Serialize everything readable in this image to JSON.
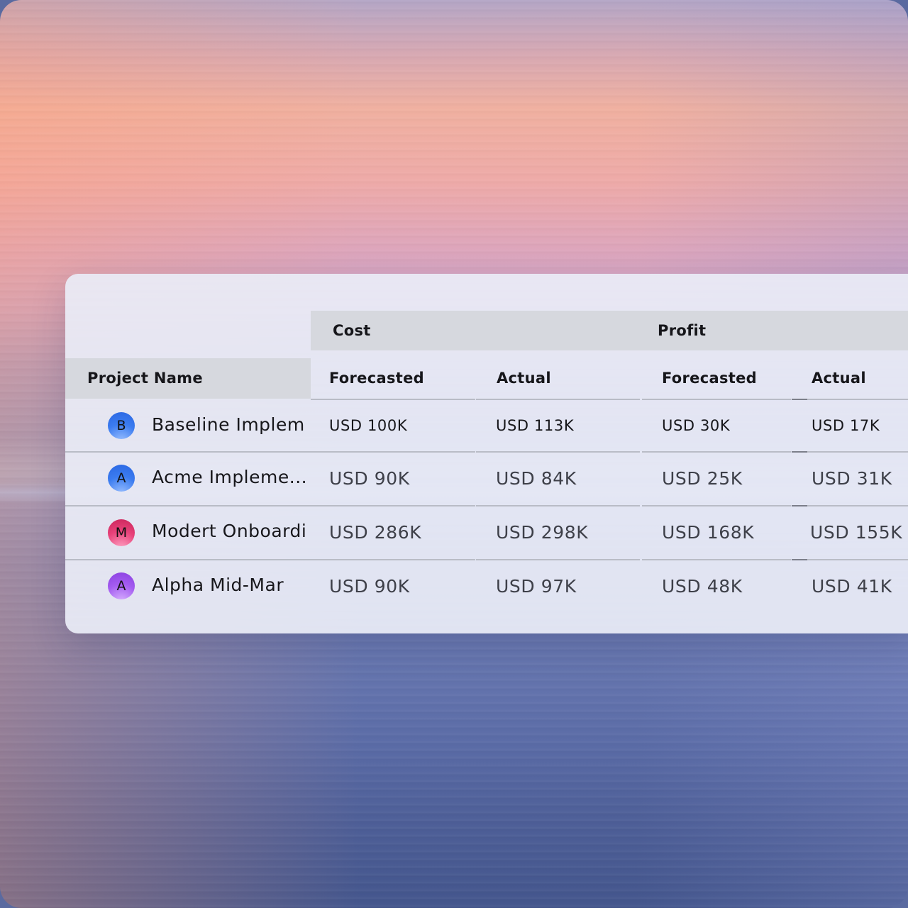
{
  "table": {
    "groups": [
      {
        "label": "Cost"
      },
      {
        "label": "Profit"
      }
    ],
    "columns": {
      "project_name": "Project Name",
      "cost_forecasted": "Forecasted",
      "cost_actual": "Actual",
      "profit_forecasted": "Forecasted",
      "profit_actual": "Actual"
    },
    "rows": [
      {
        "avatar": "B",
        "avatar_color": "#2f6fe8",
        "name": "Baseline Implem",
        "cost_forecasted": "USD 100K",
        "cost_actual": "USD 113K",
        "profit_forecasted": "USD 30K",
        "profit_actual": "USD 17K"
      },
      {
        "avatar": "A",
        "avatar_color": "#2f6fe8",
        "name": "Acme Impleme...",
        "cost_forecasted": "USD 90K",
        "cost_actual": "USD 84K",
        "profit_forecasted": "USD 25K",
        "profit_actual": "USD 31K"
      },
      {
        "avatar": "M",
        "avatar_color": "#e0386e",
        "name": "Modert Onboardi",
        "cost_forecasted": "USD 286K",
        "cost_actual": "USD 298K",
        "profit_forecasted": "USD 168K",
        "profit_actual": "USD 155K"
      },
      {
        "avatar": "A",
        "avatar_color": "#9b4fe6",
        "name": "Alpha Mid-Mar",
        "cost_forecasted": "USD 90K",
        "cost_actual": "USD 97K",
        "profit_forecasted": "USD 48K",
        "profit_actual": "USD 41K"
      }
    ]
  }
}
